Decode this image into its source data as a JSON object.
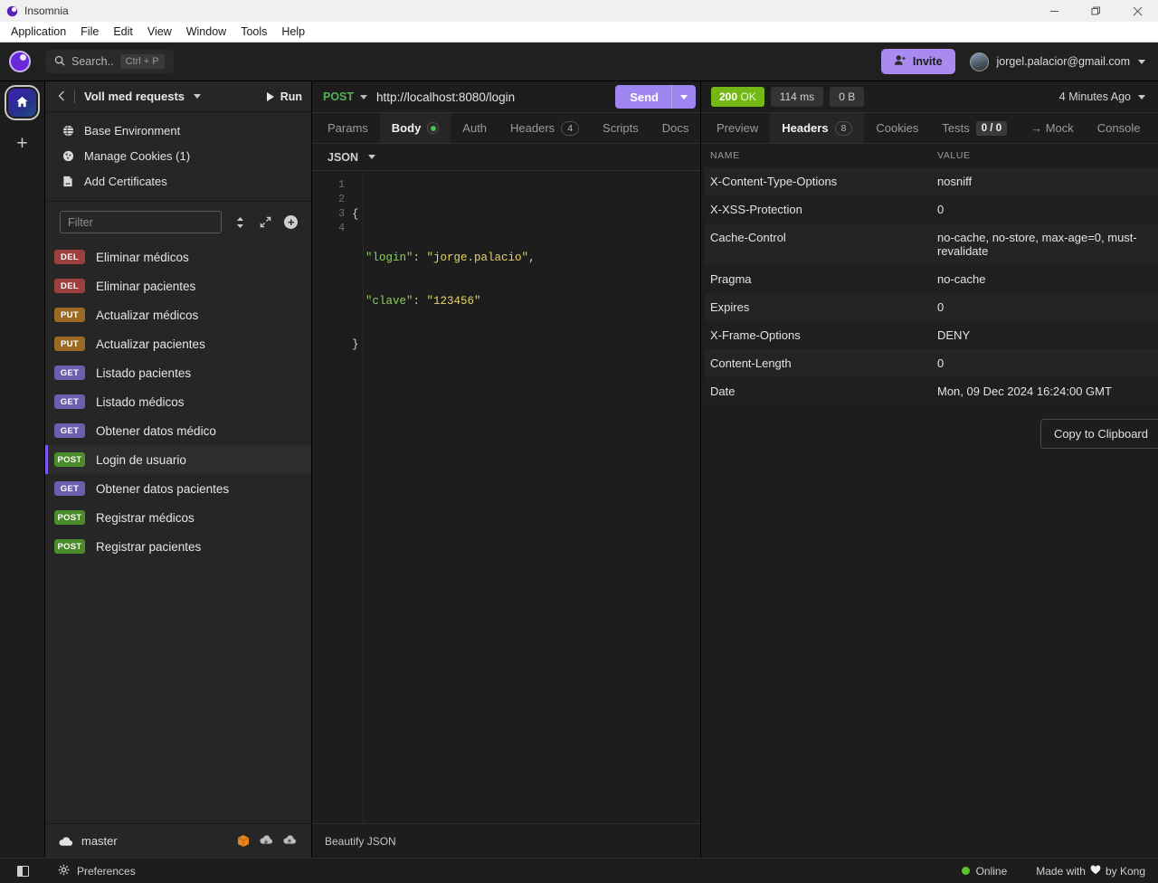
{
  "window": {
    "title": "Insomnia",
    "controls": {
      "minimize": "minimize-icon",
      "restore": "restore-icon",
      "close": "close-icon"
    }
  },
  "menubar": {
    "items": [
      "Application",
      "File",
      "Edit",
      "View",
      "Window",
      "Tools",
      "Help"
    ]
  },
  "header": {
    "search": {
      "label": "Search..",
      "shortcut": "Ctrl + P"
    },
    "invite_label": "Invite",
    "account_email": "jorgel.palacior@gmail.com"
  },
  "sidebar": {
    "workspace_name": "Voll med requests",
    "run_label": "Run",
    "environments": [
      {
        "label": "Base Environment",
        "icon": "globe-icon"
      },
      {
        "label": "Manage Cookies (1)",
        "icon": "cookie-icon"
      },
      {
        "label": "Add Certificates",
        "icon": "certificate-icon"
      }
    ],
    "filter_placeholder": "Filter",
    "filter_value": "",
    "requests": [
      {
        "method": "DEL",
        "name": "Eliminar médicos",
        "selected": false
      },
      {
        "method": "DEL",
        "name": "Eliminar pacientes",
        "selected": false
      },
      {
        "method": "PUT",
        "name": "Actualizar médicos",
        "selected": false
      },
      {
        "method": "PUT",
        "name": "Actualizar pacientes",
        "selected": false
      },
      {
        "method": "GET",
        "name": "Listado pacientes",
        "selected": false
      },
      {
        "method": "GET",
        "name": "Listado médicos",
        "selected": false
      },
      {
        "method": "GET",
        "name": "Obtener datos médico",
        "selected": false
      },
      {
        "method": "POST",
        "name": "Login de usuario",
        "selected": true
      },
      {
        "method": "GET",
        "name": "Obtener datos pacientes",
        "selected": false
      },
      {
        "method": "POST",
        "name": "Registrar médicos",
        "selected": false
      },
      {
        "method": "POST",
        "name": "Registrar pacientes",
        "selected": false
      }
    ],
    "branch": "master"
  },
  "request": {
    "method": "POST",
    "url": "http://localhost:8080/login",
    "send_label": "Send",
    "tabs": [
      {
        "label": "Params",
        "active": false,
        "badge": null,
        "dot": false
      },
      {
        "label": "Body",
        "active": true,
        "badge": null,
        "dot": true
      },
      {
        "label": "Auth",
        "active": false,
        "badge": null,
        "dot": false
      },
      {
        "label": "Headers",
        "active": false,
        "badge": "4",
        "dot": false
      },
      {
        "label": "Scripts",
        "active": false,
        "badge": null,
        "dot": false
      },
      {
        "label": "Docs",
        "active": false,
        "badge": null,
        "dot": false
      }
    ],
    "body_type": "JSON",
    "body_lines": [
      {
        "n": "1",
        "fold": true,
        "tokens": [
          {
            "t": "{",
            "c": "p"
          }
        ]
      },
      {
        "n": "2",
        "fold": false,
        "tokens": [
          {
            "t": "  \"login\"",
            "c": "k"
          },
          {
            "t": ": ",
            "c": "p"
          },
          {
            "t": "\"jorge.palacio\"",
            "c": "s"
          },
          {
            "t": ",",
            "c": "p"
          }
        ]
      },
      {
        "n": "3",
        "fold": false,
        "tokens": [
          {
            "t": "  \"clave\"",
            "c": "k"
          },
          {
            "t": ": ",
            "c": "p"
          },
          {
            "t": "\"123456\"",
            "c": "s"
          }
        ]
      },
      {
        "n": "4",
        "fold": false,
        "tokens": [
          {
            "t": "}",
            "c": "p"
          }
        ]
      }
    ],
    "beautify_label": "Beautify JSON"
  },
  "response": {
    "status_code": "200",
    "status_text": "OK",
    "time": "114 ms",
    "size": "0 B",
    "timestamp": "4 Minutes Ago",
    "tabs": [
      {
        "label": "Preview",
        "active": false,
        "badge": null
      },
      {
        "label": "Headers",
        "active": true,
        "badge": "8"
      },
      {
        "label": "Cookies",
        "active": false,
        "badge": null
      },
      {
        "label": "Tests",
        "active": false,
        "badge": "0 / 0"
      },
      {
        "label": "→ Mock",
        "active": false,
        "badge": null
      },
      {
        "label": "Console",
        "active": false,
        "badge": null
      }
    ],
    "table": {
      "columns": [
        "NAME",
        "VALUE"
      ],
      "rows": [
        {
          "name": "X-Content-Type-Options",
          "value": "nosniff"
        },
        {
          "name": "X-XSS-Protection",
          "value": "0"
        },
        {
          "name": "Cache-Control",
          "value": "no-cache, no-store, max-age=0, must-revalidate"
        },
        {
          "name": "Pragma",
          "value": "no-cache"
        },
        {
          "name": "Expires",
          "value": "0"
        },
        {
          "name": "X-Frame-Options",
          "value": "DENY"
        },
        {
          "name": "Content-Length",
          "value": "0"
        },
        {
          "name": "Date",
          "value": "Mon, 09 Dec 2024 16:24:00 GMT"
        }
      ]
    },
    "copy_label": "Copy to Clipboard"
  },
  "statusbar": {
    "preferences_label": "Preferences",
    "online_label": "Online",
    "made_with_prefix": "Made with",
    "made_with_suffix": "by Kong"
  },
  "colors": {
    "accent": "#7f5af0",
    "send": "#9f85ef",
    "invite": "#a98bf0",
    "status_ok": "#74b816",
    "method_post": "#56b257",
    "online": "#5ec22a",
    "get": "#6b5db0",
    "post": "#4b8b2a",
    "put": "#9b6b24",
    "del": "#9d3f3f"
  }
}
